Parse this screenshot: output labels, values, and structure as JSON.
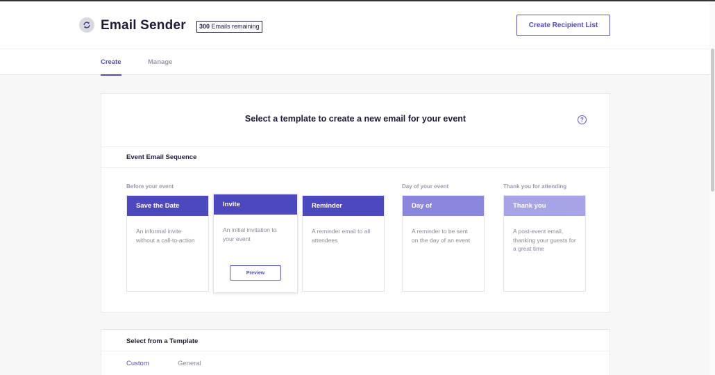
{
  "app": {
    "title": "Email Sender",
    "quota_count": "300",
    "quota_text": "Emails remaining",
    "create_list_label": "Create Recipient List",
    "logo_icon": "refresh-icon"
  },
  "tabs": [
    {
      "label": "Create",
      "active": true
    },
    {
      "label": "Manage",
      "active": false
    }
  ],
  "template_card": {
    "heading": "Select a template to create a new email for your event",
    "help_symbol": "?",
    "sequence_title": "Event Email Sequence",
    "groups": [
      {
        "label": "Before your event"
      },
      {
        "label": "Day of your event"
      },
      {
        "label": "Thank you for attending"
      }
    ],
    "templates": [
      {
        "title": "Save the Date",
        "description": "An informal invite without a call-to-action",
        "color": "#4c49bf"
      },
      {
        "title": "Invite",
        "description": "An initial invitation to your event",
        "color": "#4c49bf",
        "preview_label": "Preview"
      },
      {
        "title": "Reminder",
        "description": "A reminder email to all attendees",
        "color": "#4c49bf"
      },
      {
        "title": "Day of",
        "description": "A reminder to be sent on the day of an event",
        "color": "#8a86dc"
      },
      {
        "title": "Thank you",
        "description": "A post-event email, thanking your guests for a great time",
        "color": "#a6a3e6"
      }
    ]
  },
  "select_card": {
    "title": "Select from a Template",
    "tabs": [
      {
        "label": "Custom",
        "active": true
      },
      {
        "label": "General",
        "active": false
      }
    ]
  },
  "colors": {
    "accent": "#4f4cc0",
    "text_dark": "#1e1b3a",
    "text_muted": "#9a98b0"
  }
}
